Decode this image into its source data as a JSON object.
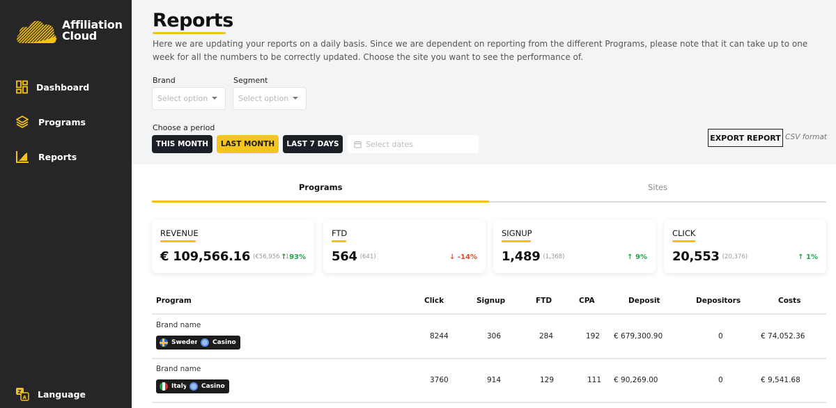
{
  "app": {
    "name_line1": "Affiliation",
    "name_line2": "Cloud",
    "brand_color": "#f2c21b"
  },
  "sidebar": {
    "items": [
      {
        "label": "Dashboard",
        "icon": "dashboard-icon"
      },
      {
        "label": "Programs",
        "icon": "layers-icon"
      },
      {
        "label": "Reports",
        "icon": "chart-icon"
      }
    ],
    "language": {
      "label": "Language",
      "icon": "translate-icon"
    }
  },
  "page": {
    "title": "Reports",
    "intro": "Here we are updating your reports on a daily basis. Since we are dependent on reporting from the different Programs, please note that it can take up to one week for all the numbers to be correctly updated. Choose the site you want to see the performance of."
  },
  "filters": {
    "brand": {
      "label": "Brand",
      "placeholder": "Select option"
    },
    "segment": {
      "label": "Segment",
      "placeholder": "Select option"
    },
    "period_label": "Choose a period",
    "periods": [
      {
        "label": "THIS MONTH",
        "active": false
      },
      {
        "label": "LAST MONTH",
        "active": true
      },
      {
        "label": "LAST 7 DAYS",
        "active": false
      }
    ],
    "dates_placeholder": "Select dates"
  },
  "export": {
    "label": "EXPORT REPORT",
    "note": "CSV format"
  },
  "tabs": [
    {
      "label": "Programs",
      "active": true
    },
    {
      "label": "Sites",
      "active": false
    }
  ],
  "cards": [
    {
      "label": "REVENUE",
      "value": "€ 109,566.16",
      "previous": "(€56,956.71)",
      "change": "93%",
      "direction": "up"
    },
    {
      "label": "FTD",
      "value": "564",
      "previous": "(641)",
      "change": "-14%",
      "direction": "down"
    },
    {
      "label": "SIGNUP",
      "value": "1,489",
      "previous": "(1,368)",
      "change": "9%",
      "direction": "up"
    },
    {
      "label": "CLICK",
      "value": "20,553",
      "previous": "(20,376)",
      "change": "1%",
      "direction": "up"
    }
  ],
  "table": {
    "columns": [
      "Program",
      "Click",
      "Signup",
      "FTD",
      "CPA",
      "Deposit",
      "Depositors",
      "Costs"
    ],
    "rows": [
      {
        "program": "Brand name",
        "country": "Sweden",
        "segment": "Casino",
        "click": "8244",
        "signup": "306",
        "ftd": "284",
        "cpa": "192",
        "deposit": "€ 679,300.90",
        "depositors": "0",
        "costs": "€ 74,052.36"
      },
      {
        "program": "Brand name",
        "country": "Italy",
        "segment": "Casino",
        "click": "3760",
        "signup": "914",
        "ftd": "129",
        "cpa": "111",
        "deposit": "€ 90,269.00",
        "depositors": "0",
        "costs": "€ 9,541.68"
      }
    ]
  }
}
